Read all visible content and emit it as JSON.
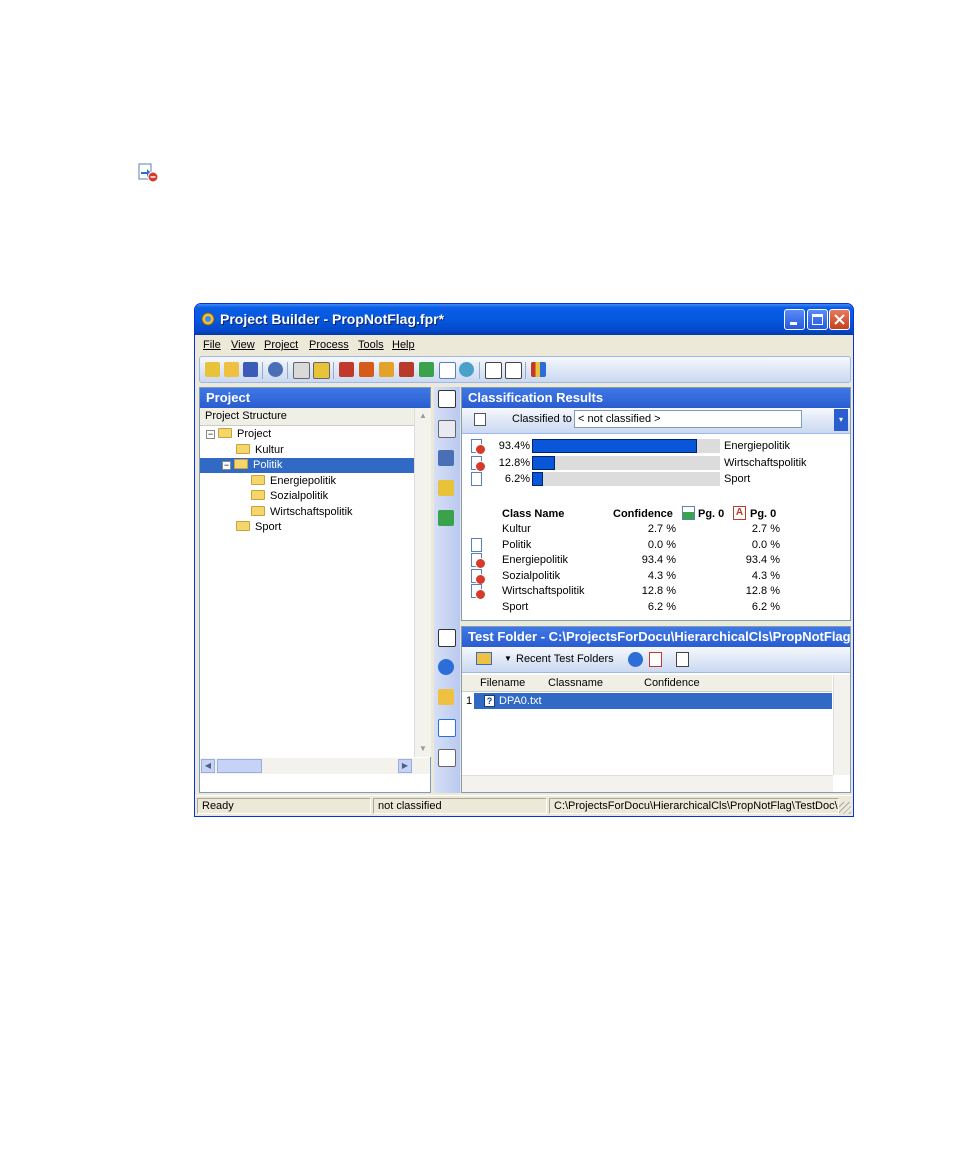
{
  "window": {
    "title": "Project Builder - PropNotFlag.fpr*",
    "menu": [
      "File",
      "View",
      "Project",
      "Process",
      "Tools",
      "Help"
    ]
  },
  "project_panel": {
    "header": "Project",
    "column_header": "Project Structure",
    "tree": [
      {
        "label": "Project",
        "level": 0,
        "expander": "⊟"
      },
      {
        "label": "Kultur",
        "level": 1
      },
      {
        "label": "Politik",
        "level": 1,
        "expander": "⊟",
        "selected": true
      },
      {
        "label": "Energiepolitik",
        "level": 2
      },
      {
        "label": "Sozialpolitik",
        "level": 2
      },
      {
        "label": "Wirtschaftspolitik",
        "level": 2
      },
      {
        "label": "Sport",
        "level": 1
      }
    ]
  },
  "classification": {
    "header": "Classification Results",
    "classified_to_label": "Classified to",
    "classified_to_value": "< not classified >",
    "bars": [
      {
        "percent_label": "93.4%",
        "value": 93.4,
        "name": "Energiepolitik",
        "hit": true
      },
      {
        "percent_label": "12.8%",
        "value": 12.8,
        "name": "Wirtschaftspolitik",
        "hit": true
      },
      {
        "percent_label": "6.2%",
        "value": 6.2,
        "name": "Sport",
        "hit": false
      }
    ],
    "table_headers": {
      "class_name": "Class Name",
      "confidence": "Confidence",
      "pg1": "Pg. 0",
      "pg2": "Pg. 0"
    },
    "rows": [
      {
        "name": "Kultur",
        "confidence": "2.7 %",
        "pg": "2.7 %",
        "icon": "none"
      },
      {
        "name": "Politik",
        "confidence": "0.0 %",
        "pg": "0.0 %",
        "icon": "doc"
      },
      {
        "name": "Energiepolitik",
        "confidence": "93.4 %",
        "pg": "93.4 %",
        "icon": "hit"
      },
      {
        "name": "Sozialpolitik",
        "confidence": "4.3 %",
        "pg": "4.3 %",
        "icon": "hit"
      },
      {
        "name": "Wirtschaftspolitik",
        "confidence": "12.8 %",
        "pg": "12.8 %",
        "icon": "hit"
      },
      {
        "name": "Sport",
        "confidence": "6.2 %",
        "pg": "6.2 %",
        "icon": "none"
      }
    ]
  },
  "test_folder": {
    "header": "Test Folder - C:\\ProjectsForDocu\\HierarchicalCls\\PropNotFlag\\",
    "recent_label": "Recent Test Folders",
    "columns": [
      "Filename",
      "Classname",
      "Confidence"
    ],
    "rows": [
      {
        "index": "1",
        "filename": "DPA0.txt"
      }
    ]
  },
  "status": {
    "left": "Ready",
    "middle": "not classified",
    "right": "C:\\ProjectsForDocu\\HierarchicalCls\\PropNotFlag\\TestDoc\\D"
  },
  "colors": {
    "accent": "#316AC5",
    "bar": "#0A56D8",
    "hit": "#D63A2A"
  }
}
